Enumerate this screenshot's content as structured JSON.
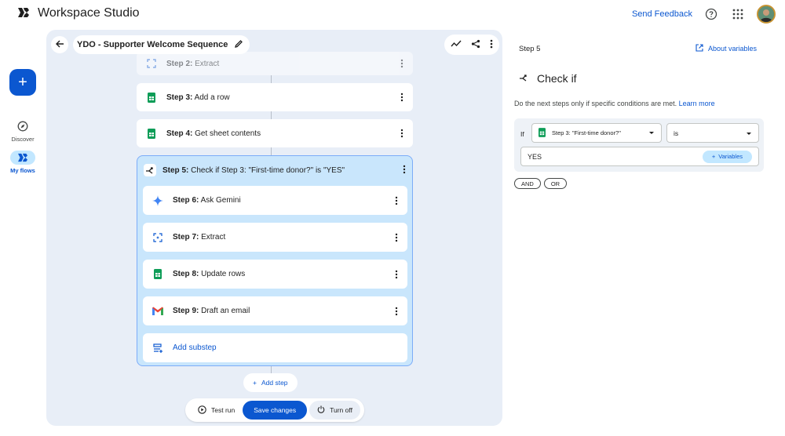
{
  "app": {
    "title": "Workspace Studio"
  },
  "header": {
    "feedback": "Send Feedback",
    "help_icon": "help-icon",
    "apps_icon": "apps-grid-icon",
    "avatar_icon": "user-avatar"
  },
  "rail": {
    "new_icon": "plus-icon",
    "items": [
      {
        "label": "Discover",
        "icon": "compass-icon",
        "active": false
      },
      {
        "label": "My flows",
        "icon": "flows-icon",
        "active": true
      }
    ]
  },
  "flow": {
    "name": "YDO - Supporter Welcome Sequence",
    "steps": [
      {
        "step": "Step 2:",
        "label": "Extract",
        "icon": "extract-icon"
      },
      {
        "step": "Step 3:",
        "label": "Add a row",
        "icon": "sheets-icon"
      },
      {
        "step": "Step 4:",
        "label": "Get sheet contents",
        "icon": "sheets-icon"
      }
    ],
    "group": {
      "step": "Step 5:",
      "label": "Check if Step 3: \"First-time donor?\" is \"YES\"",
      "icon": "branch-icon",
      "substeps": [
        {
          "step": "Step 6:",
          "label": "Ask Gemini",
          "icon": "gemini-icon"
        },
        {
          "step": "Step 7:",
          "label": "Extract",
          "icon": "extract-icon"
        },
        {
          "step": "Step 8:",
          "label": "Update rows",
          "icon": "sheets-icon"
        },
        {
          "step": "Step 9:",
          "label": "Draft an email",
          "icon": "gmail-icon"
        }
      ],
      "add_substep": "Add substep"
    },
    "add_step": "Add step",
    "actions": {
      "test_run": "Test run",
      "save": "Save changes",
      "turn_off": "Turn off"
    }
  },
  "panel": {
    "step": "Step 5",
    "about": "About variables",
    "title": "Check if",
    "description": "Do the next steps only if specific conditions are met.",
    "learn_more": "Learn more",
    "condition": {
      "if_label": "If",
      "field": "Step 3: \"First-time donor?\"",
      "operator": "is",
      "value": "YES",
      "variables": "Variables"
    },
    "logic": {
      "and": "AND",
      "or": "OR"
    }
  },
  "colors": {
    "accent": "#0b57d0",
    "canvas": "#e8eef7",
    "group_fill": "#c9e6fc",
    "group_border": "#7cacf8",
    "sheets": "#0f9d58"
  }
}
